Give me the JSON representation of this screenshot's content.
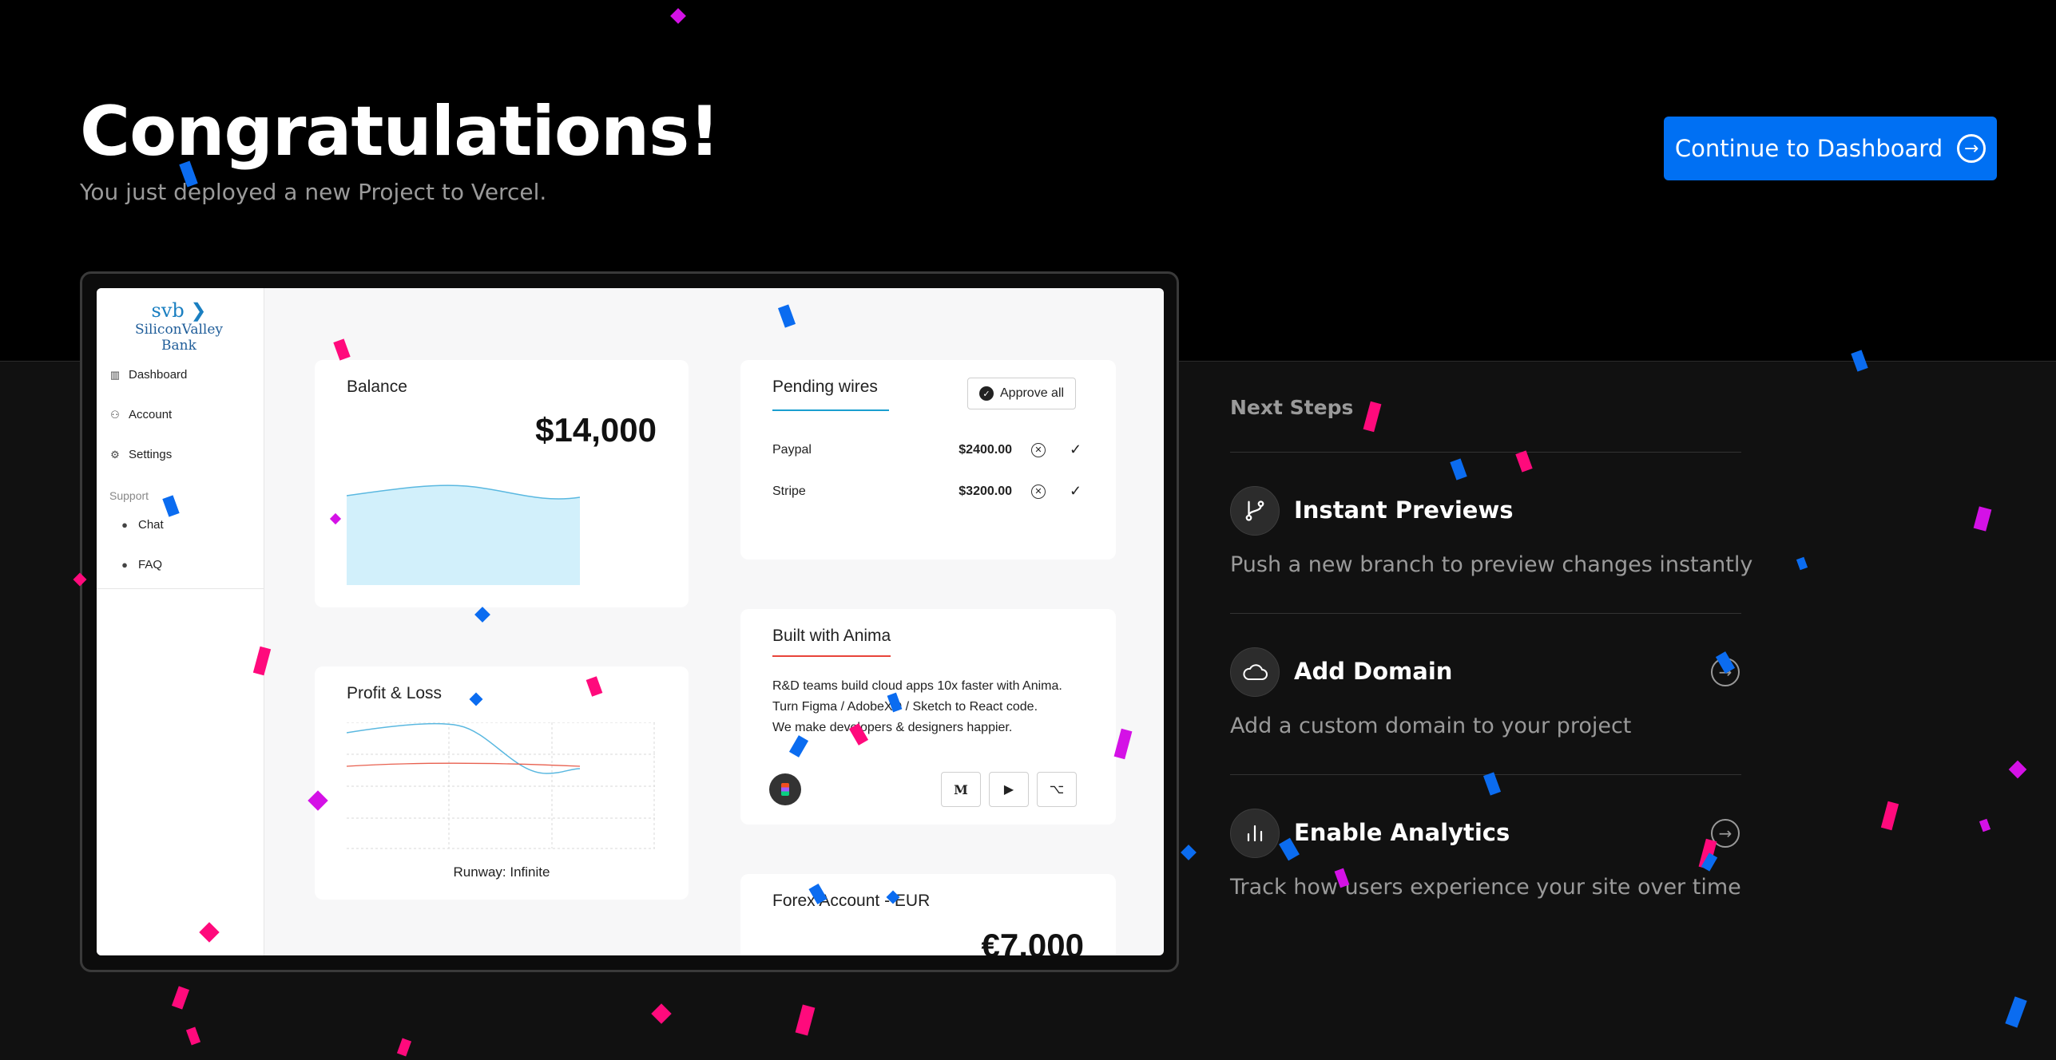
{
  "header": {
    "title": "Congratulations!",
    "subtitle": "You just deployed a new Project to Vercel.",
    "cta_label": "Continue to Dashboard",
    "cta_icon": "arrow-right-circle-icon"
  },
  "preview": {
    "logo": {
      "mark": "svb ❯",
      "name": "SiliconValley Bank"
    },
    "sidebar": {
      "items": [
        {
          "label": "Dashboard",
          "icon": "chart-icon"
        },
        {
          "label": "Account",
          "icon": "user-icon"
        },
        {
          "label": "Settings",
          "icon": "gear-icon"
        }
      ],
      "support_label": "Support",
      "support_items": [
        {
          "label": "Chat",
          "icon": "chat-icon"
        },
        {
          "label": "FAQ",
          "icon": "question-icon"
        }
      ]
    },
    "balance": {
      "title": "Balance",
      "amount": "$14,000"
    },
    "pending": {
      "title": "Pending wires",
      "approve_label": "Approve all",
      "rows": [
        {
          "name": "Paypal",
          "amount": "$2400.00"
        },
        {
          "name": "Stripe",
          "amount": "$3200.00"
        }
      ]
    },
    "anima": {
      "title": "Built with Anima",
      "lines": [
        "R&D teams build cloud apps 10x faster with Anima.",
        "Turn Figma / AdobeXD / Sketch to React code.",
        "We make developers & designers happier."
      ],
      "socials": [
        "M",
        "▶",
        "⌥"
      ]
    },
    "profit": {
      "title": "Profit & Loss",
      "runway": "Runway: Infinite"
    },
    "forex": {
      "title": "Forex Account - EUR",
      "amount": "€7,000"
    }
  },
  "next_steps": {
    "title": "Next Steps",
    "items": [
      {
        "title": "Instant Previews",
        "desc": "Push a new branch to preview changes instantly",
        "icon": "git-branch-icon",
        "has_arrow": false
      },
      {
        "title": "Add Domain",
        "desc": "Add a custom domain to your project",
        "icon": "cloud-icon",
        "has_arrow": true
      },
      {
        "title": "Enable Analytics",
        "desc": "Track how users experience your site over time",
        "icon": "bar-chart-icon",
        "has_arrow": true
      }
    ]
  },
  "colors": {
    "accent": "#0070f3",
    "confetti_pink": "#ff0a7c",
    "confetti_magenta": "#d411e6",
    "confetti_blue": "#0b6cf0"
  }
}
